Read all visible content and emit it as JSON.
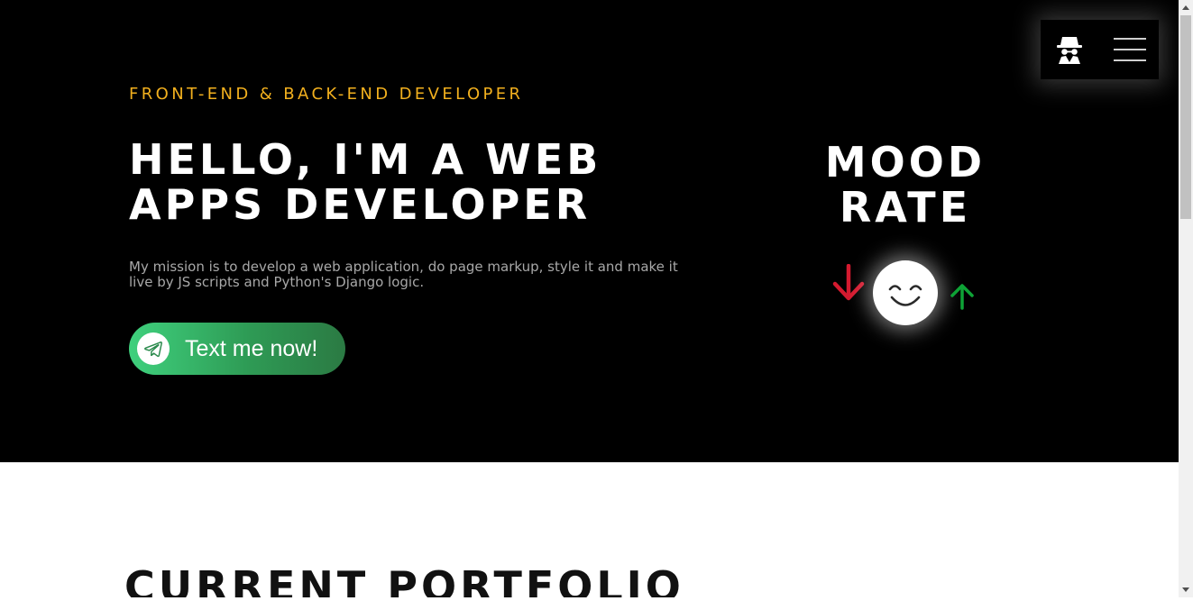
{
  "hero": {
    "eyebrow": "FRONT-END & BACK-END DEVELOPER",
    "headline_line1": "HELLO, I'M A WEB",
    "headline_line2": "APPS DEVELOPER",
    "mission": "My mission is to develop a web application, do page markup, style it and make it live by JS scripts and Python's Django logic.",
    "cta_label": "Text me now!",
    "cta_icon": "telegram-icon",
    "cta_gradient": [
      "#3fd07d",
      "#2b7a43"
    ]
  },
  "mood": {
    "title_line1": "MOOD",
    "title_line2": "RATE",
    "down_icon": "arrow-down-icon",
    "face_icon": "smiley-icon",
    "up_icon": "arrow-up-icon",
    "down_color": "#d41a2f",
    "up_color": "#0ea336"
  },
  "nav": {
    "incognito_icon": "spy-incognito-icon",
    "menu_icon": "hamburger-menu-icon"
  },
  "portfolio": {
    "title": "CURRENT PORTFOLIO"
  },
  "colors": {
    "hero_background": "#000000",
    "accent": "#f2b01e"
  }
}
